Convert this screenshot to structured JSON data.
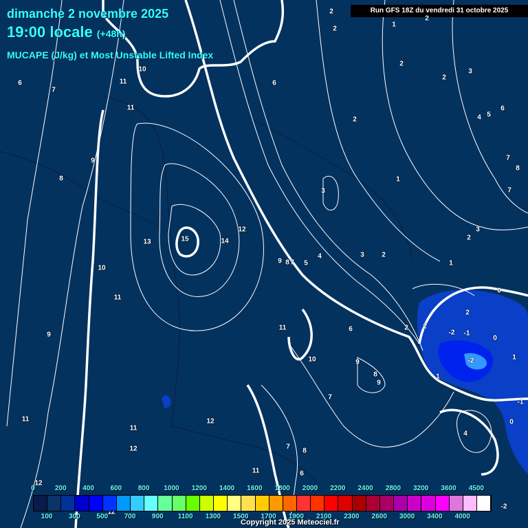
{
  "header": {
    "date": "dimanche 2 novembre 2025",
    "time": "19:00 locale",
    "lead": "(+48h)",
    "parameter": "MUCAPE (J/kg) et Most Unstable Lifted Index",
    "run": "Run GFS 18Z du vendredi 31 octobre 2025"
  },
  "contour_labels": [
    "2",
    "2",
    "1",
    "2",
    "6",
    "7",
    "10",
    "11",
    "11",
    "6",
    "2",
    "2",
    "3",
    "2",
    "4",
    "5",
    "6",
    "9",
    "8",
    "7",
    "8",
    "7",
    "3",
    "1",
    "15",
    "13",
    "14",
    "12",
    "3",
    "2",
    "3",
    "2",
    "4",
    "5",
    "9",
    "8",
    "7",
    "1",
    "10",
    "11",
    "0",
    "2",
    "2",
    "2",
    "-2",
    "-1",
    "0",
    "11",
    "6",
    "9",
    "10",
    "9",
    "-2",
    "1",
    "8",
    "9",
    "1",
    "7",
    "-1",
    "11",
    "12",
    "11",
    "0",
    "4",
    "12",
    "7",
    "8",
    "11",
    "6",
    "12",
    "12",
    "-2"
  ],
  "colorbar": {
    "colors": [
      "#0a1a4a",
      "#0a3366",
      "#003399",
      "#0000cc",
      "#0000ff",
      "#0033ff",
      "#0099ff",
      "#33ccff",
      "#66ffff",
      "#66ff99",
      "#66ff66",
      "#66ff00",
      "#ccff00",
      "#ffff00",
      "#ffff80",
      "#ffe050",
      "#ffcc00",
      "#ff9900",
      "#ff6600",
      "#ff3333",
      "#ff3300",
      "#ff0000",
      "#dd0000",
      "#aa0000",
      "#aa0033",
      "#aa0066",
      "#aa00aa",
      "#cc00cc",
      "#dd00dd",
      "#ff00ff",
      "#dd77dd",
      "#ffbbff",
      "#ffffff"
    ],
    "top_labels": [
      "0",
      "200",
      "400",
      "600",
      "800",
      "1000",
      "1200",
      "1400",
      "1600",
      "1800",
      "2000",
      "2200",
      "2400",
      "2800",
      "3200",
      "3600",
      "4500"
    ],
    "bottom_labels": [
      "100",
      "300",
      "500",
      "700",
      "900",
      "1100",
      "1300",
      "1500",
      "1700",
      "1900",
      "2100",
      "2300",
      "2600",
      "3000",
      "3400",
      "4000"
    ]
  },
  "copyright": "Copyright 2025 Meteociel.fr"
}
